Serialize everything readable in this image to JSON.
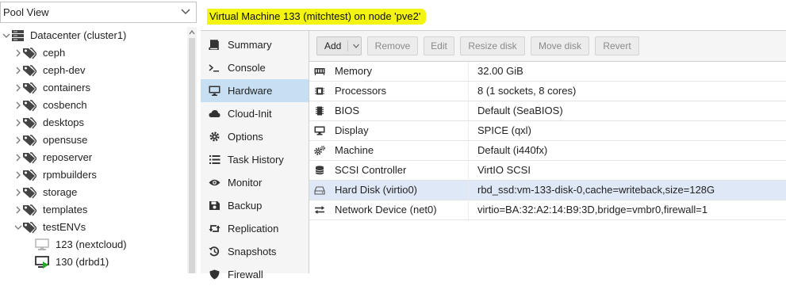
{
  "pool_select": {
    "value": "Pool View"
  },
  "tree": {
    "datacenter": "Datacenter (cluster1)",
    "pools": [
      "ceph",
      "ceph-dev",
      "containers",
      "cosbench",
      "desktops",
      "opensuse",
      "reposerver",
      "rpmbuilders",
      "storage",
      "templates",
      "testENVs"
    ],
    "vms": [
      {
        "label": "123 (nextcloud)",
        "status": "stopped"
      },
      {
        "label": "130 (drbd1)",
        "status": "running"
      }
    ]
  },
  "header": {
    "title": "Virtual Machine 133 (mitchtest) on node 'pve2'"
  },
  "nav": {
    "items": [
      {
        "label": "Summary",
        "icon": "book-icon"
      },
      {
        "label": "Console",
        "icon": "terminal-icon"
      },
      {
        "label": "Hardware",
        "icon": "desktop-icon",
        "active": true
      },
      {
        "label": "Cloud-Init",
        "icon": "cloud-icon"
      },
      {
        "label": "Options",
        "icon": "gear-icon"
      },
      {
        "label": "Task History",
        "icon": "list-icon"
      },
      {
        "label": "Monitor",
        "icon": "eye-icon"
      },
      {
        "label": "Backup",
        "icon": "floppy-icon"
      },
      {
        "label": "Replication",
        "icon": "retweet-icon"
      },
      {
        "label": "Snapshots",
        "icon": "history-icon"
      },
      {
        "label": "Firewall",
        "icon": "shield-icon"
      }
    ]
  },
  "toolbar": {
    "add": "Add",
    "remove": "Remove",
    "edit": "Edit",
    "resize_disk": "Resize disk",
    "move_disk": "Move disk",
    "revert": "Revert"
  },
  "hardware": [
    {
      "name": "Memory",
      "value": "32.00 GiB",
      "icon": "memory-icon"
    },
    {
      "name": "Processors",
      "value": "8 (1 sockets, 8 cores)",
      "icon": "cpu-icon"
    },
    {
      "name": "BIOS",
      "value": "Default (SeaBIOS)",
      "icon": "microchip-icon"
    },
    {
      "name": "Display",
      "value": "SPICE (qxl)",
      "icon": "monitor-icon"
    },
    {
      "name": "Machine",
      "value": "Default (i440fx)",
      "icon": "cogs-icon"
    },
    {
      "name": "SCSI Controller",
      "value": "VirtIO SCSI",
      "icon": "database-icon"
    },
    {
      "name": "Hard Disk (virtio0)",
      "value": "rbd_ssd:vm-133-disk-0,cache=writeback,size=128G",
      "icon": "hdd-icon",
      "selected": true
    },
    {
      "name": "Network Device (net0)",
      "value": "virtio=BA:32:A2:14:B9:3D,bridge=vmbr0,firewall=1",
      "icon": "exchange-icon"
    }
  ],
  "colors": {
    "highlight": "#f4f412",
    "nav_active": "#c6dff3",
    "row_selected": "#dfe8f6",
    "running": "#27a827"
  }
}
